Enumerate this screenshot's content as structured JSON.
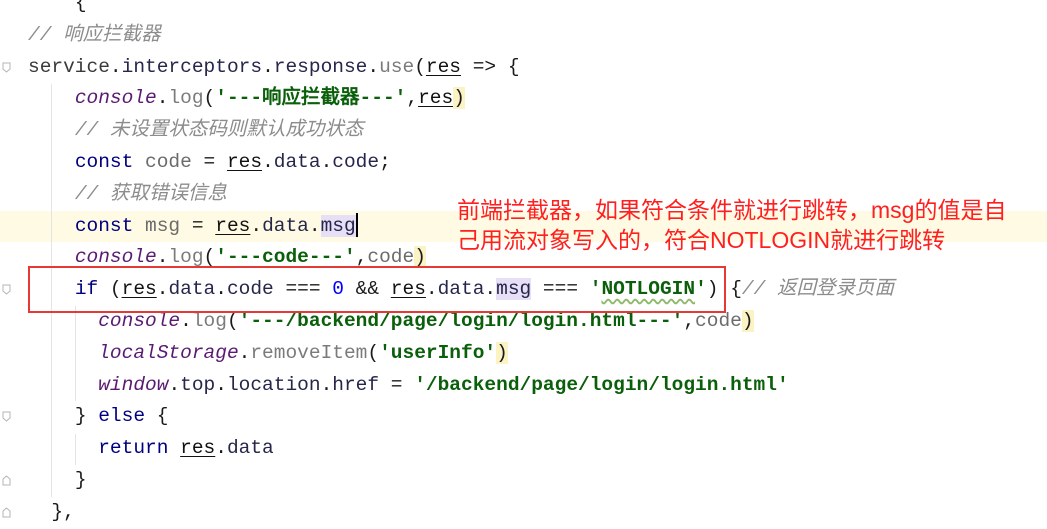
{
  "editor": {
    "lines": [
      {
        "tokens": [
          {
            "t": "    ",
            "type": "whitespace"
          },
          {
            "t": "{",
            "type": "punctuation"
          }
        ]
      },
      {
        "tokens": [
          {
            "t": "// 响应拦截器",
            "type": "comment"
          }
        ]
      },
      {
        "fold": "fold-start-icon",
        "tokens": [
          {
            "t": "service",
            "type": "identifier"
          },
          {
            "t": ".",
            "type": "punctuation"
          },
          {
            "t": "interceptors",
            "type": "property"
          },
          {
            "t": ".",
            "type": "punctuation"
          },
          {
            "t": "response",
            "type": "property"
          },
          {
            "t": ".",
            "type": "punctuation"
          },
          {
            "t": "use",
            "type": "method"
          },
          {
            "t": "(",
            "type": "punctuation"
          },
          {
            "t": "res",
            "type": "parameter"
          },
          {
            "t": " => {",
            "type": "punctuation"
          }
        ]
      },
      {
        "tokens": [
          {
            "t": "    ",
            "type": "whitespace"
          },
          {
            "t": "console",
            "type": "global"
          },
          {
            "t": ".",
            "type": "punctuation"
          },
          {
            "t": "log",
            "type": "method"
          },
          {
            "t": "(",
            "type": "punctuation"
          },
          {
            "t": "'---响应拦截器---'",
            "type": "string"
          },
          {
            "t": ",",
            "type": "punctuation"
          },
          {
            "t": "res",
            "type": "parameter"
          },
          {
            "t": ")",
            "type": "punctuation",
            "hl": "brace"
          }
        ]
      },
      {
        "tokens": [
          {
            "t": "    ",
            "type": "whitespace"
          },
          {
            "t": "// 未设置状态码则默认成功状态",
            "type": "comment"
          }
        ]
      },
      {
        "tokens": [
          {
            "t": "    ",
            "type": "whitespace"
          },
          {
            "t": "const",
            "type": "keyword"
          },
          {
            "t": " ",
            "type": "punctuation"
          },
          {
            "t": "code",
            "type": "variable"
          },
          {
            "t": " = ",
            "type": "punctuation"
          },
          {
            "t": "res",
            "type": "parameter"
          },
          {
            "t": ".",
            "type": "punctuation"
          },
          {
            "t": "data",
            "type": "property"
          },
          {
            "t": ".",
            "type": "punctuation"
          },
          {
            "t": "code",
            "type": "property"
          },
          {
            "t": ";",
            "type": "punctuation"
          }
        ]
      },
      {
        "tokens": [
          {
            "t": "    ",
            "type": "whitespace"
          },
          {
            "t": "// 获取错误信息",
            "type": "comment"
          }
        ]
      },
      {
        "current": true,
        "tokens": [
          {
            "t": "    ",
            "type": "whitespace"
          },
          {
            "t": "const",
            "type": "keyword"
          },
          {
            "t": " ",
            "type": "punctuation"
          },
          {
            "t": "msg",
            "type": "variable"
          },
          {
            "t": " = ",
            "type": "punctuation"
          },
          {
            "t": "res",
            "type": "parameter"
          },
          {
            "t": ".",
            "type": "punctuation"
          },
          {
            "t": "data",
            "type": "property"
          },
          {
            "t": ".",
            "type": "punctuation"
          },
          {
            "t": "msg",
            "type": "property",
            "hl": "occurrence"
          },
          {
            "type": "caret"
          }
        ]
      },
      {
        "tokens": [
          {
            "t": "    ",
            "type": "whitespace"
          },
          {
            "t": "console",
            "type": "global"
          },
          {
            "t": ".",
            "type": "punctuation"
          },
          {
            "t": "log",
            "type": "method"
          },
          {
            "t": "(",
            "type": "punctuation"
          },
          {
            "t": "'---code---'",
            "type": "string"
          },
          {
            "t": ",",
            "type": "punctuation"
          },
          {
            "t": "code",
            "type": "variable"
          },
          {
            "t": ")",
            "type": "punctuation",
            "hl": "brace"
          }
        ]
      },
      {
        "fold": "fold-start-icon",
        "tokens": [
          {
            "t": "    ",
            "type": "whitespace"
          },
          {
            "t": "if",
            "type": "keyword"
          },
          {
            "t": " (",
            "type": "punctuation"
          },
          {
            "t": "res",
            "type": "parameter"
          },
          {
            "t": ".",
            "type": "punctuation"
          },
          {
            "t": "data",
            "type": "property"
          },
          {
            "t": ".",
            "type": "punctuation"
          },
          {
            "t": "code",
            "type": "property"
          },
          {
            "t": " === ",
            "type": "punctuation"
          },
          {
            "t": "0",
            "type": "number"
          },
          {
            "t": " && ",
            "type": "punctuation"
          },
          {
            "t": "res",
            "type": "parameter"
          },
          {
            "t": ".",
            "type": "punctuation"
          },
          {
            "t": "data",
            "type": "property"
          },
          {
            "t": ".",
            "type": "punctuation"
          },
          {
            "t": "msg",
            "type": "property",
            "hl": "occurrence"
          },
          {
            "t": " === ",
            "type": "punctuation"
          },
          {
            "t": "'",
            "type": "string"
          },
          {
            "t": "NOTLOGIN",
            "type": "string",
            "hl": "typo"
          },
          {
            "t": "'",
            "type": "string"
          },
          {
            "t": ") ",
            "type": "punctuation"
          },
          {
            "t": "{",
            "type": "punctuation"
          },
          {
            "t": "// 返回登录页面",
            "type": "comment"
          }
        ]
      },
      {
        "tokens": [
          {
            "t": "      ",
            "type": "whitespace"
          },
          {
            "t": "console",
            "type": "global"
          },
          {
            "t": ".",
            "type": "punctuation"
          },
          {
            "t": "log",
            "type": "method"
          },
          {
            "t": "(",
            "type": "punctuation"
          },
          {
            "t": "'---/backend/page/login/login.html---'",
            "type": "string"
          },
          {
            "t": ",",
            "type": "punctuation"
          },
          {
            "t": "code",
            "type": "variable"
          },
          {
            "t": ")",
            "type": "punctuation",
            "hl": "brace"
          }
        ]
      },
      {
        "tokens": [
          {
            "t": "      ",
            "type": "whitespace"
          },
          {
            "t": "localStorage",
            "type": "global"
          },
          {
            "t": ".",
            "type": "punctuation"
          },
          {
            "t": "removeItem",
            "type": "method"
          },
          {
            "t": "(",
            "type": "punctuation"
          },
          {
            "t": "'userInfo'",
            "type": "string"
          },
          {
            "t": ")",
            "type": "punctuation",
            "hl": "brace"
          }
        ]
      },
      {
        "tokens": [
          {
            "t": "      ",
            "type": "whitespace"
          },
          {
            "t": "window",
            "type": "global"
          },
          {
            "t": ".",
            "type": "punctuation"
          },
          {
            "t": "top",
            "type": "property"
          },
          {
            "t": ".",
            "type": "punctuation"
          },
          {
            "t": "location",
            "type": "property"
          },
          {
            "t": ".",
            "type": "punctuation"
          },
          {
            "t": "href",
            "type": "property"
          },
          {
            "t": " = ",
            "type": "punctuation"
          },
          {
            "t": "'/backend/page/login/login.html'",
            "type": "string"
          }
        ]
      },
      {
        "fold": "fold-start-icon",
        "tokens": [
          {
            "t": "    ",
            "type": "whitespace"
          },
          {
            "t": "} ",
            "type": "punctuation"
          },
          {
            "t": "else",
            "type": "keyword"
          },
          {
            "t": " {",
            "type": "punctuation"
          }
        ]
      },
      {
        "tokens": [
          {
            "t": "      ",
            "type": "whitespace"
          },
          {
            "t": "return",
            "type": "keyword"
          },
          {
            "t": " ",
            "type": "punctuation"
          },
          {
            "t": "res",
            "type": "parameter"
          },
          {
            "t": ".",
            "type": "punctuation"
          },
          {
            "t": "data",
            "type": "property"
          }
        ]
      },
      {
        "fold": "fold-end-icon",
        "tokens": [
          {
            "t": "    ",
            "type": "whitespace"
          },
          {
            "t": "}",
            "type": "punctuation"
          }
        ]
      },
      {
        "fold": "fold-end-icon",
        "tokens": [
          {
            "t": "  ",
            "type": "whitespace"
          },
          {
            "t": "},",
            "type": "punctuation"
          }
        ]
      }
    ]
  },
  "annotation": {
    "lines": [
      "前端拦截器，如果符合条件就进行跳转，msg的值是自",
      "己用流对象写入的，符合NOTLOGIN就进行跳转"
    ]
  },
  "colors": {
    "annotation": "#ff1f1f",
    "highlight_box": "#e53935",
    "comment": "#8c8c8c",
    "keyword": "#000080",
    "string": "#0a5f0a",
    "number": "#0000ff",
    "global": "#5a1a72",
    "method": "#7b7b7b",
    "property": "#26264a",
    "variable": "#6b6b6b",
    "identifier": "#3a3a3a",
    "current_line": "#fffae3",
    "occurrence_highlight": "#e6dff5",
    "brace_highlight": "#fcf3c4",
    "typo_underline": "#8fb96a"
  }
}
